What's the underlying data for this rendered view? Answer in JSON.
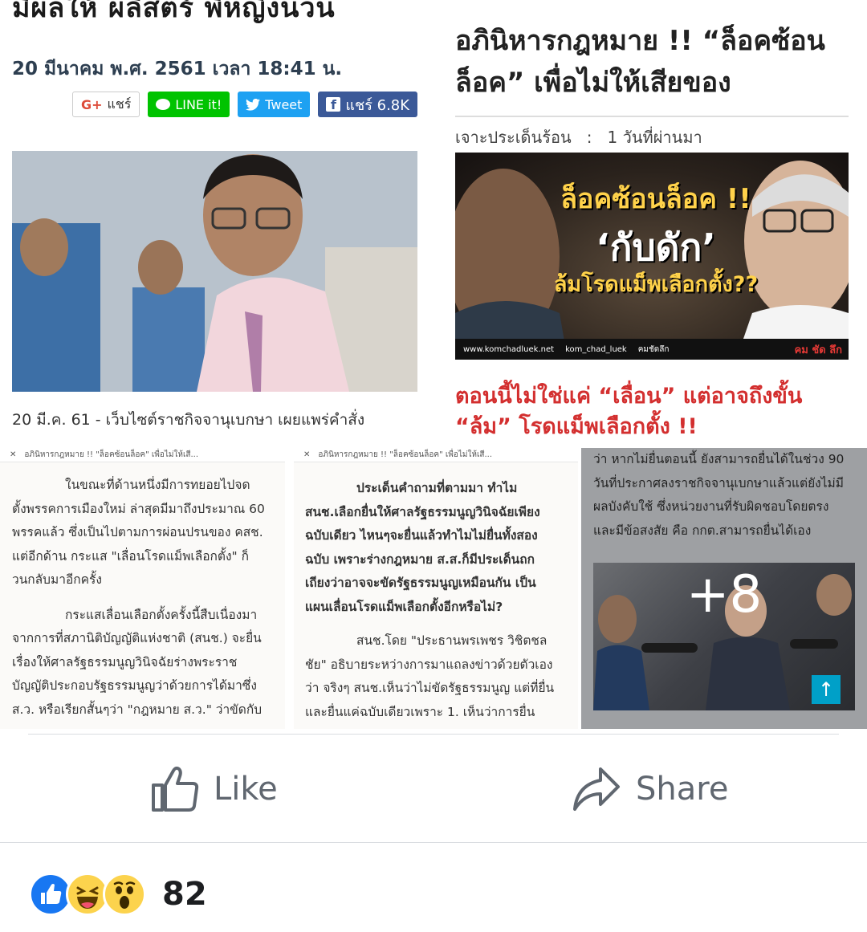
{
  "article_left": {
    "cut_headline": "มีผลให้ ผลิสตร์ พี่หญิงนวน",
    "date": "20 มีนาคม พ.ศ. 2561 เวลา 18:41 น.",
    "share_buttons": {
      "gplus": "แชร์",
      "line": "LINE it!",
      "tweet": "Tweet",
      "fb_share": "แชร์ 6.8K"
    },
    "caption": "20 มี.ค. 61 - เว็บไซต์ราชกิจจานุเบกษา  เผยแพร่คำสั่ง"
  },
  "article_right": {
    "headline": "อภินิหารกฎหมาย !! “ล็อคซ้อนล็อค” เพื่อไม่ให้เสียของ",
    "meta_category": "เจาะประเด็นร้อน",
    "meta_sep": ":",
    "meta_time": "1 วันที่ผ่านมา",
    "banner": {
      "line1": "ล็อคซ้อนล็อค !!",
      "line2": "‘กับดัก’",
      "line3": "ล้มโรดแม็พเลือกตั้ง??",
      "footer_site": "www.komchadluek.net",
      "footer_twitter": "kom_chad_luek",
      "footer_fb": "คมชัดลึก",
      "footer_logo": "คม ชัด ลึก"
    },
    "red_headline": "ตอนนี้ไม่ใช่แค่ “เลื่อน” แต่อาจถึงขั้น “ล้ม” โรดแม็พเลือกตั้ง !!"
  },
  "shots": {
    "tab_title": "อภินิหารกฎหมาย !! \"ล็อคซ้อนล็อค\" เพื่อไม่ให้เสี...",
    "shot1_p1_a": "ในขณะที่ด้านหนึ่งมีการทยอยไปจด",
    "shot1_p1_b": "ตั้งพรรคการเมืองใหม่ ล่าสุดมีมาถึงประมาณ 60",
    "shot1_p1_c": "พรรคแล้ว ซึ่งเป็นไปตามการผ่อนปรนของ คสช.",
    "shot1_p1_d": "แต่อีกด้าน กระแส \"เลื่อนโรดแม็พเลือกตั้ง\" ก็",
    "shot1_p1_e": "วนกลับมาอีกครั้ง",
    "shot1_p2_a": "กระแสเลื่อนเลือกตั้งครั้งนี้สืบเนื่องมา",
    "shot1_p2_b": "จากการที่สภานิติบัญญัติแห่งชาติ (สนช.) จะยื่น",
    "shot1_p2_c": "เรื่องให้ศาลรัฐธรรมนูญวินิจฉัยร่างพระราช",
    "shot1_p2_d": "บัญญัติประกอบรัฐธรรมนูญว่าด้วยการได้มาซึ่ง",
    "shot1_p2_e": "ส.ว. หรือเรียกสั้นๆว่า \"กฎหมาย ส.ว.\" ว่าขัดกับ",
    "shot2_p1_a": "ประเด็นคำถามที่ตามมา ทำไม",
    "shot2_p1_b": "สนช.เลือกยื่นให้ศาลรัฐธรรมนูญวินิจฉัยเพียง",
    "shot2_p1_c": "ฉบับเดียว ไหนๆจะยื่นแล้วทำไมไม่ยื่นทั้งสอง",
    "shot2_p1_d": "ฉบับ เพราะร่างกฎหมาย ส.ส.ก็มีประเด็นถก",
    "shot2_p1_e": "เถียงว่าอาจจะขัดรัฐธรรมนูญเหมือนกัน เป็น",
    "shot2_p1_f": "แผนเลื่อนโรดแม็พเลือกตั้งอีกหรือไม่?",
    "shot2_p2_a": "สนช.โดย \"ประธานพรเพชร วิชิตชล",
    "shot2_p2_b": "ชัย\" อธิบายระหว่างการมาแถลงข่าวด้วยตัวเอง",
    "shot2_p2_c": "ว่า จริงๆ สนช.เห็นว่าไม่ขัดรัฐธรรมนูญ แต่ที่ยื่น",
    "shot2_p2_d": "และยื่นแค่ฉบับเดียวเพราะ 1. เห็นว่าการยื่น",
    "shot3_a": "ว่า หากไม่ยื่นตอนนี้ ยังสามารถยื่นได้ในช่วง 90",
    "shot3_b": "วันที่ประกาศลงราชกิจจานุเบกษาแล้วแต่ยังไม่มี",
    "shot3_c": "ผลบังคับใช้ ซึ่งหน่วยงานที่รับผิดชอบโดยตรง",
    "shot3_d": "และมีข้อสงสัย คือ กกต.สามารถยื่นได้เอง",
    "more_count": "+8"
  },
  "actions": {
    "like": "Like",
    "share": "Share"
  },
  "reactions": {
    "types": [
      "like",
      "haha",
      "wow"
    ],
    "count": "82"
  },
  "colors": {
    "facebook_blue": "#1877f2",
    "action_gray": "#606770",
    "headline_red": "#d32f2f",
    "line_green": "#00c300",
    "twitter_blue": "#1da1f2",
    "fb_share_blue": "#3b5998"
  }
}
